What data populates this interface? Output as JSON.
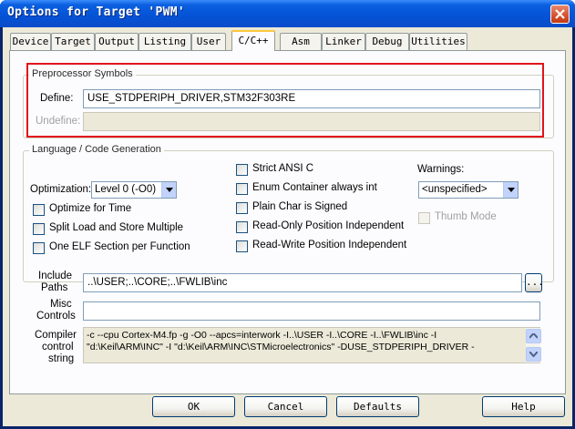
{
  "window": {
    "title": "Options for Target 'PWM'"
  },
  "tabs": [
    {
      "label": "Device"
    },
    {
      "label": "Target"
    },
    {
      "label": "Output"
    },
    {
      "label": "Listing"
    },
    {
      "label": "User"
    },
    {
      "label": "C/C++"
    },
    {
      "label": "Asm"
    },
    {
      "label": "Linker"
    },
    {
      "label": "Debug"
    },
    {
      "label": "Utilities"
    }
  ],
  "preprocessor": {
    "group_label": "Preprocessor Symbols",
    "define_label": "Define:",
    "define_value": "USE_STDPERIPH_DRIVER,STM32F303RE",
    "undefine_label": "Undefine:",
    "undefine_value": ""
  },
  "language": {
    "group_label": "Language / Code Generation",
    "optimization_label": "Optimization:",
    "optimization_value": "Level 0 (-O0)",
    "optimize_time": "Optimize for Time",
    "split_load": "Split Load and Store Multiple",
    "one_elf": "One ELF Section per Function",
    "strict_ansi": "Strict ANSI C",
    "enum_container": "Enum Container always int",
    "plain_char": "Plain Char is Signed",
    "ropi": "Read-Only Position Independent",
    "rwpi": "Read-Write Position Independent",
    "warnings_label": "Warnings:",
    "warnings_value": "<unspecified>",
    "thumb_mode": "Thumb Mode"
  },
  "include_paths": {
    "label_1": "Include",
    "label_2": "Paths",
    "value": "..\\USER;..\\CORE;..\\FWLIB\\inc",
    "browse_label": "..."
  },
  "misc_controls": {
    "label_1": "Misc",
    "label_2": "Controls",
    "value": ""
  },
  "compiler_string": {
    "label_1": "Compiler",
    "label_2": "control",
    "label_3": "string",
    "line_1": "-c --cpu Cortex-M4.fp -g -O0 --apcs=interwork -I..\\USER -I..\\CORE -I..\\FWLIB\\inc -I",
    "line_2": "\"d:\\Keil\\ARM\\INC\" -I \"d:\\Keil\\ARM\\INC\\STMicroelectronics\" -DUSE_STDPERIPH_DRIVER -"
  },
  "buttons": {
    "ok": "OK",
    "cancel": "Cancel",
    "defaults": "Defaults",
    "help": "Help"
  },
  "colors": {
    "title_bar": "#0552d6",
    "highlight_box": "#e0141c",
    "dialog_face": "#ece9d8"
  }
}
